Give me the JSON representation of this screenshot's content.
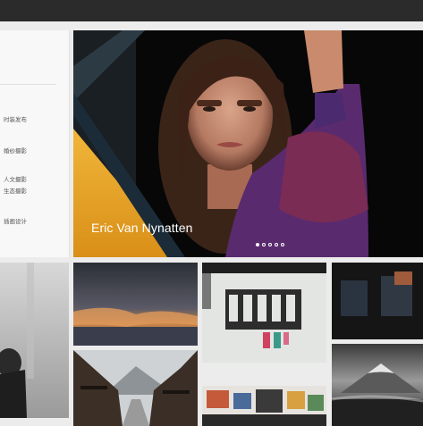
{
  "sidebar": {
    "items": [
      {
        "label": "时装发布"
      },
      {
        "label": "婚纱摄影"
      },
      {
        "label": "人文摄影"
      },
      {
        "label": "生态摄影"
      },
      {
        "label": "插画设计"
      }
    ]
  },
  "hero": {
    "caption": "Eric Van Nynatten",
    "slide_count": 5,
    "active_slide": 1
  },
  "gallery": {
    "tiles": [
      {
        "subject": "foggy-portrait"
      },
      {
        "subject": "sunset-clouds"
      },
      {
        "subject": "laundry-building"
      },
      {
        "subject": "dark-interior"
      },
      {
        "subject": "mountain-village"
      },
      {
        "subject": "colorful-street"
      },
      {
        "subject": "mountain-mist"
      }
    ]
  }
}
